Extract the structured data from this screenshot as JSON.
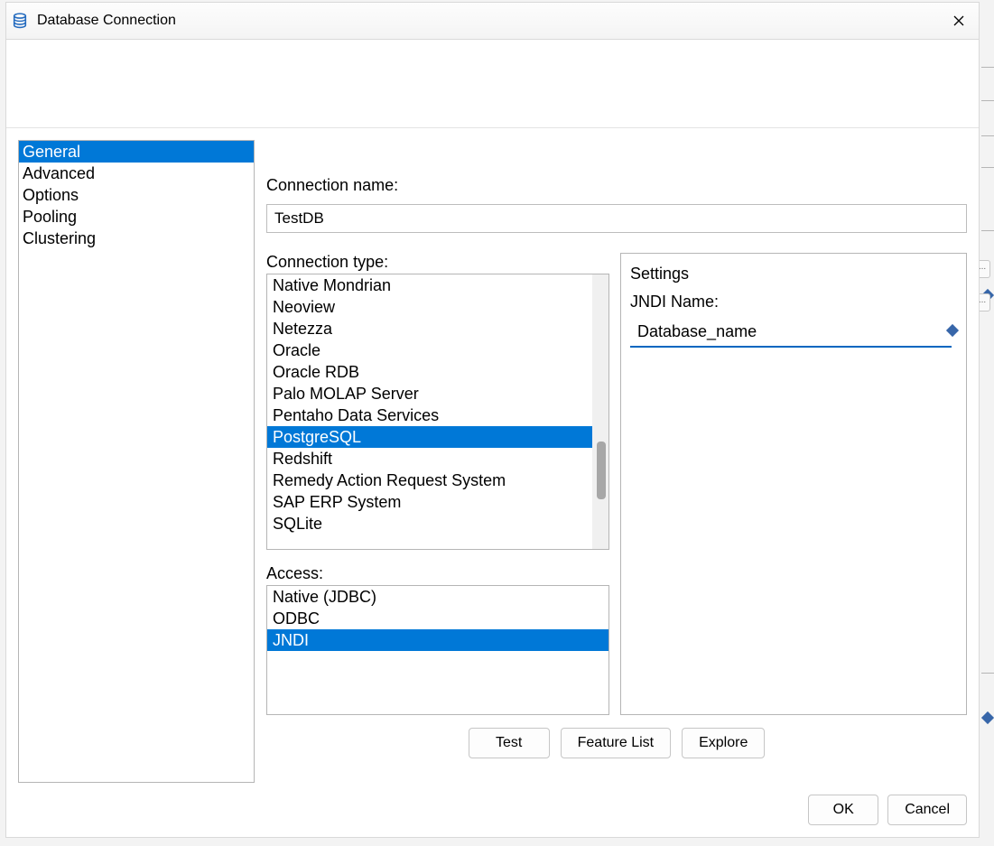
{
  "window": {
    "title": "Database Connection"
  },
  "nav": {
    "items": [
      "General",
      "Advanced",
      "Options",
      "Pooling",
      "Clustering"
    ],
    "selected_index": 0
  },
  "form": {
    "connection_name_label": "Connection name:",
    "connection_name_value": "TestDB",
    "connection_type_label": "Connection type:",
    "access_label": "Access:"
  },
  "connection_types": {
    "items": [
      "Native Mondrian",
      "Neoview",
      "Netezza",
      "Oracle",
      "Oracle RDB",
      "Palo MOLAP Server",
      "Pentaho Data Services",
      "PostgreSQL",
      "Redshift",
      "Remedy Action Request System",
      "SAP ERP System",
      "SQLite"
    ],
    "selected_index": 7
  },
  "access_methods": {
    "items": [
      "Native (JDBC)",
      "ODBC",
      "JNDI"
    ],
    "selected_index": 2
  },
  "settings": {
    "title": "Settings",
    "jndi_label": "JNDI Name:",
    "jndi_value": "Database_name"
  },
  "buttons": {
    "test": "Test",
    "feature_list": "Feature List",
    "explore": "Explore",
    "ok": "OK",
    "cancel": "Cancel"
  }
}
